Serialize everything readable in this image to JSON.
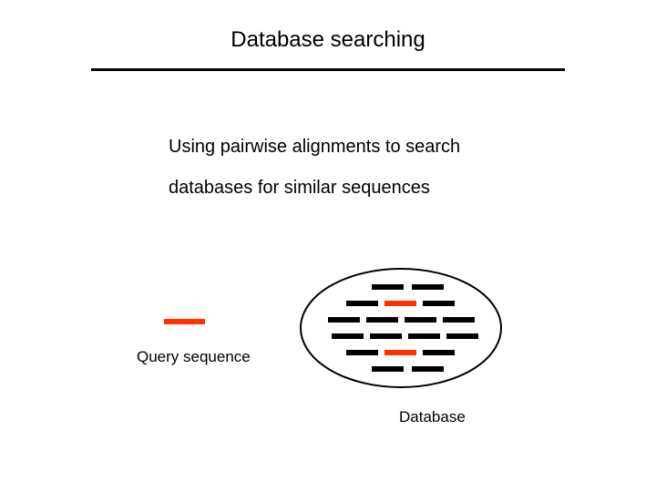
{
  "title": "Database searching",
  "body": {
    "line1": "Using pairwise alignments to search",
    "line2": "databases for similar sequences"
  },
  "labels": {
    "query": "Query sequence",
    "database": "Database"
  },
  "colors": {
    "highlight": "#ff3300",
    "sequence": "#000000",
    "ellipse_stroke": "#000000"
  }
}
